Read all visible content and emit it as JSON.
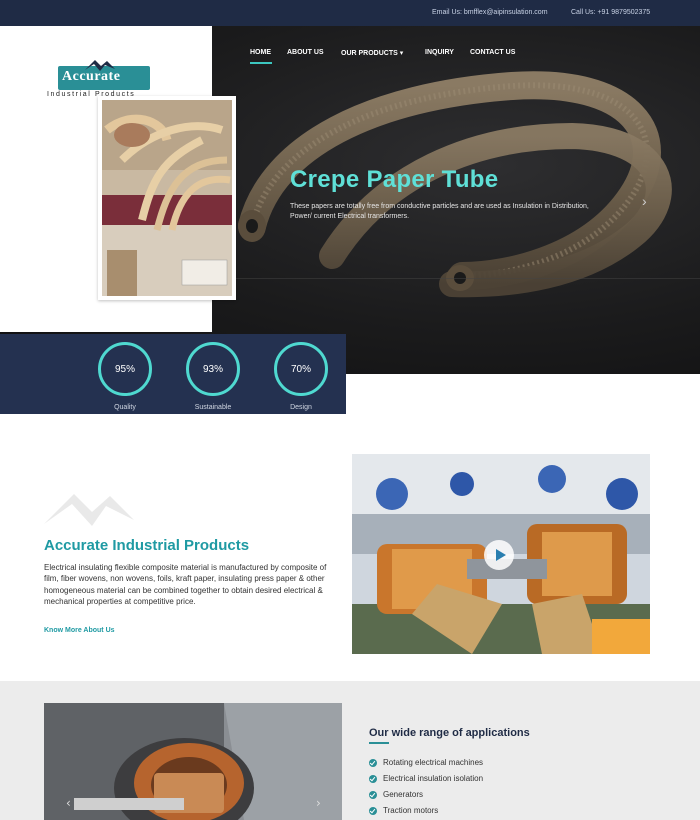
{
  "topbar": {
    "email": "Email Us: bmfflex@aipinsulation.com",
    "phone": "Call Us: +91 9879502375"
  },
  "brand": {
    "name": "Accurate",
    "tagline": "Industrial Products"
  },
  "nav": {
    "items": [
      {
        "label": "HOME",
        "active": true
      },
      {
        "label": "ABOUT US"
      },
      {
        "label": "OUR PRODUCTS ▾"
      },
      {
        "label": "INQUIRY"
      },
      {
        "label": "CONTACT US"
      }
    ]
  },
  "hero": {
    "title": "Crepe Paper Tube",
    "description": "These papers are totally free from conductive particles and are used as Insulation in Distribution, Power/ current Electrical transformers.",
    "next_arrow": "›"
  },
  "stats": [
    {
      "value": "95%",
      "label": "Quality"
    },
    {
      "value": "93%",
      "label": "Sustainable"
    },
    {
      "value": "70%",
      "label": "Design"
    }
  ],
  "about": {
    "title": "Accurate Industrial Products",
    "text": "Electrical insulating flexible composite material is manufactured by composite of film, fiber wovens, non wovens, foils, kraft paper, insulating press paper & other homogeneous material can be combined together to obtain desired electrical & mechanical properties at competitive price.",
    "link": "Know More About Us"
  },
  "applications": {
    "title": "Our wide range of applications",
    "items": [
      "Rotating electrical machines",
      "Electrical insulation isolation",
      "Generators",
      "Traction motors"
    ]
  },
  "colors": {
    "navy": "#1f2b45",
    "teal": "#2a8f96",
    "hero_title": "#5fe0d7"
  }
}
